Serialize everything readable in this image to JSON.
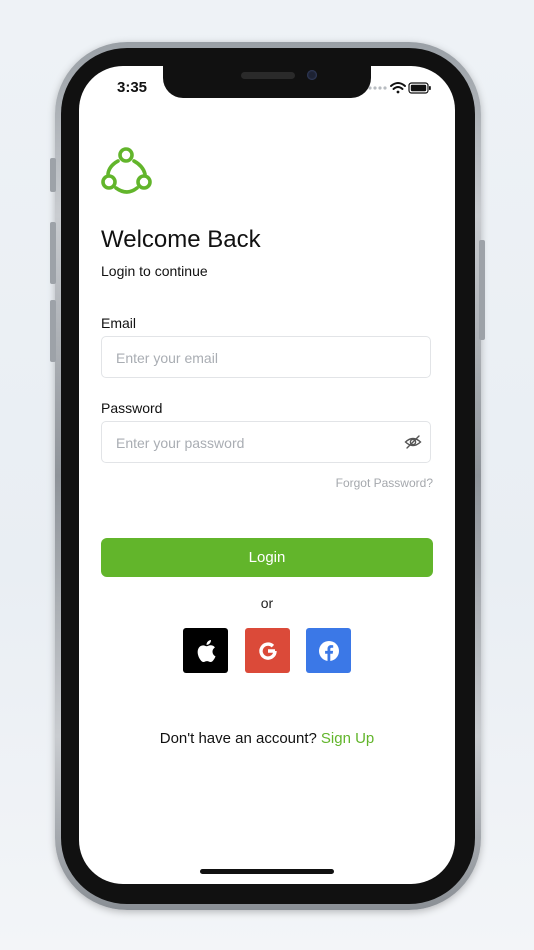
{
  "status_bar": {
    "time": "3:35"
  },
  "colors": {
    "accent": "#62b52b",
    "apple": "#000000",
    "google": "#db4a39",
    "facebook": "#3b78e7"
  },
  "header": {
    "title": "Welcome Back",
    "subtitle": "Login to continue"
  },
  "form": {
    "email": {
      "label": "Email",
      "placeholder": "Enter your email",
      "value": ""
    },
    "password": {
      "label": "Password",
      "placeholder": "Enter your password",
      "value": ""
    },
    "forgot_label": "Forgot Password?",
    "login_label": "Login"
  },
  "divider": {
    "label": "or"
  },
  "social": [
    {
      "name": "apple",
      "icon": "apple-icon"
    },
    {
      "name": "google",
      "icon": "google-icon"
    },
    {
      "name": "facebook",
      "icon": "facebook-icon"
    }
  ],
  "footer": {
    "prompt": "Don't have an account?",
    "signup_label": "Sign Up"
  },
  "icons": {
    "logo": "share-nodes-icon",
    "password_toggle": "eye-off-icon",
    "wifi": "wifi-icon",
    "battery": "battery-icon",
    "signal": "signal-dots-icon"
  }
}
